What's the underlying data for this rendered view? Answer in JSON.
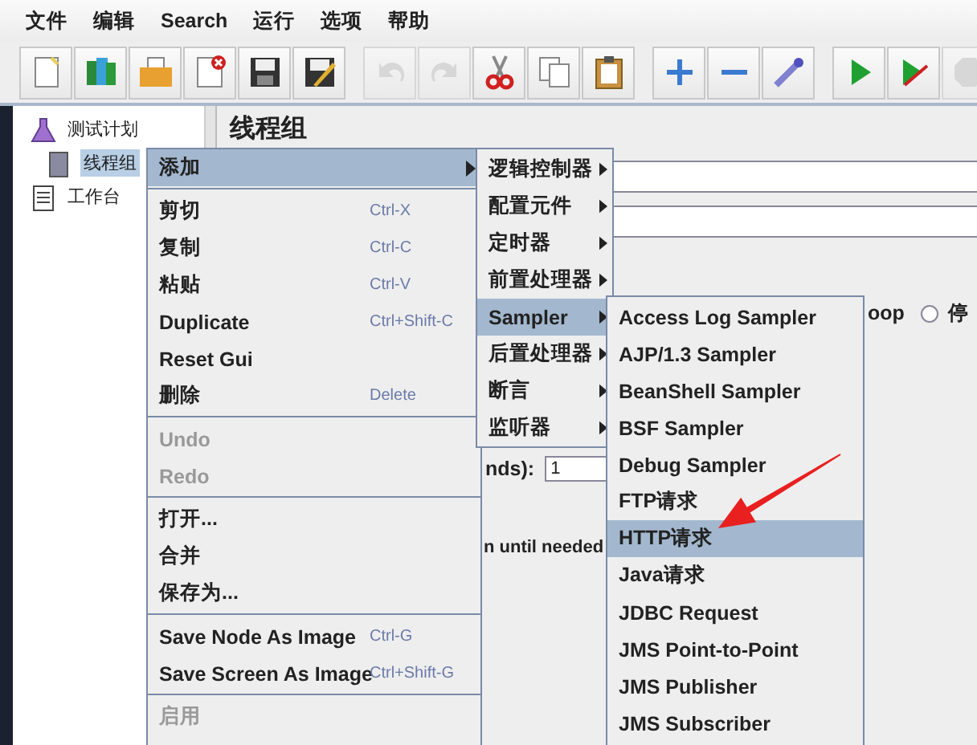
{
  "menu_bar": [
    "文件",
    "编辑",
    "Search",
    "运行",
    "选项",
    "帮助"
  ],
  "toolbar": [
    {
      "kind": "new",
      "disabled": false
    },
    {
      "kind": "templates",
      "disabled": false
    },
    {
      "kind": "open",
      "disabled": false
    },
    {
      "kind": "close",
      "disabled": false
    },
    {
      "kind": "save",
      "disabled": false
    },
    {
      "kind": "save-as",
      "disabled": false
    },
    {
      "kind": "undo",
      "disabled": true
    },
    {
      "kind": "redo",
      "disabled": true
    },
    {
      "kind": "cut",
      "disabled": false
    },
    {
      "kind": "copy",
      "disabled": false
    },
    {
      "kind": "paste",
      "disabled": false
    },
    {
      "kind": "expand",
      "disabled": false
    },
    {
      "kind": "collapse",
      "disabled": false
    },
    {
      "kind": "toggle",
      "disabled": false
    },
    {
      "kind": "start",
      "disabled": false
    },
    {
      "kind": "start-no-pause",
      "disabled": false
    },
    {
      "kind": "stop",
      "disabled": true
    }
  ],
  "tree": [
    {
      "label": "测试计划",
      "kind": "plan",
      "selected": false,
      "children": [
        {
          "label": "线程组",
          "kind": "thread",
          "selected": true
        }
      ]
    },
    {
      "label": "工作台",
      "kind": "bench",
      "selected": false
    }
  ],
  "panel": {
    "title": "线程组",
    "loop_label": "oop",
    "stop_option": {
      "label": "停",
      "selected": false
    },
    "field_label": "nds):",
    "field_value": "1",
    "note": "n until needed"
  },
  "context_menu": {
    "groups": [
      [
        {
          "label": "添加",
          "disabled": false,
          "selected": true,
          "has_submenu": true
        }
      ],
      [
        {
          "label": "剪切",
          "shortcut": "Ctrl-X",
          "disabled": false,
          "selected": false,
          "has_submenu": false
        },
        {
          "label": "复制",
          "shortcut": "Ctrl-C",
          "disabled": false,
          "selected": false,
          "has_submenu": false
        },
        {
          "label": "粘贴",
          "shortcut": "Ctrl-V",
          "disabled": false,
          "selected": false,
          "has_submenu": false
        },
        {
          "label": "Duplicate",
          "shortcut": "Ctrl+Shift-C",
          "disabled": false,
          "selected": false,
          "has_submenu": false
        },
        {
          "label": "Reset Gui",
          "disabled": false,
          "selected": false,
          "has_submenu": false
        },
        {
          "label": "删除",
          "shortcut": "Delete",
          "disabled": false,
          "selected": false,
          "has_submenu": false
        }
      ],
      [
        {
          "label": "Undo",
          "disabled": true,
          "selected": false,
          "has_submenu": false
        },
        {
          "label": "Redo",
          "disabled": true,
          "selected": false,
          "has_submenu": false
        }
      ],
      [
        {
          "label": "打开...",
          "disabled": false,
          "selected": false,
          "has_submenu": false
        },
        {
          "label": "合并",
          "disabled": false,
          "selected": false,
          "has_submenu": false
        },
        {
          "label": "保存为...",
          "disabled": false,
          "selected": false,
          "has_submenu": false
        }
      ],
      [
        {
          "label": "Save Node As Image",
          "shortcut": "Ctrl-G",
          "disabled": false,
          "selected": false,
          "has_submenu": false
        },
        {
          "label": "Save Screen As Image",
          "shortcut": "Ctrl+Shift-G",
          "disabled": false,
          "selected": false,
          "has_submenu": false
        }
      ],
      [
        {
          "label": "启用",
          "disabled": true,
          "selected": false,
          "has_submenu": false
        }
      ]
    ]
  },
  "add_submenu": [
    {
      "label": "逻辑控制器",
      "selected": false
    },
    {
      "label": "配置元件",
      "selected": false
    },
    {
      "label": "定时器",
      "selected": false
    },
    {
      "label": "前置处理器",
      "selected": false
    },
    {
      "label": "Sampler",
      "selected": true
    },
    {
      "label": "后置处理器",
      "selected": false
    },
    {
      "label": "断言",
      "selected": false
    },
    {
      "label": "监听器",
      "selected": false
    }
  ],
  "sampler_submenu": [
    {
      "label": "Access Log Sampler",
      "selected": false
    },
    {
      "label": "AJP/1.3 Sampler",
      "selected": false
    },
    {
      "label": "BeanShell Sampler",
      "selected": false
    },
    {
      "label": "BSF Sampler",
      "selected": false
    },
    {
      "label": "Debug Sampler",
      "selected": false
    },
    {
      "label": "FTP请求",
      "selected": false
    },
    {
      "label": "HTTP请求",
      "selected": true
    },
    {
      "label": "Java请求",
      "selected": false
    },
    {
      "label": "JDBC Request",
      "selected": false
    },
    {
      "label": "JMS Point-to-Point",
      "selected": false
    },
    {
      "label": "JMS Publisher",
      "selected": false
    },
    {
      "label": "JMS Subscriber",
      "selected": false
    }
  ]
}
